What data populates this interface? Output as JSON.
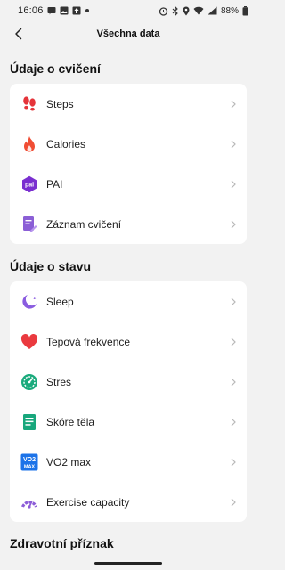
{
  "status_bar": {
    "time": "16:06",
    "battery": "88%"
  },
  "header": {
    "title": "Všechna data"
  },
  "sections": [
    {
      "title": "Údaje o cvičení",
      "items": [
        {
          "label": "Steps",
          "icon": "footsteps-icon",
          "color": "#e5343a"
        },
        {
          "label": "Calories",
          "icon": "flame-icon",
          "color": "#f04d34"
        },
        {
          "label": "PAI",
          "icon": "pai-icon",
          "color": "#7a2fd0"
        },
        {
          "label": "Záznam cvičení",
          "icon": "exercise-record-icon",
          "color": "#8b5fd6"
        }
      ]
    },
    {
      "title": "Údaje o stavu",
      "items": [
        {
          "label": "Sleep",
          "icon": "moon-icon",
          "color": "#8a5ce0"
        },
        {
          "label": "Tepová frekvence",
          "icon": "heart-icon",
          "color": "#ea3a3f"
        },
        {
          "label": "Stres",
          "icon": "stress-gauge-icon",
          "color": "#1aaa7c"
        },
        {
          "label": "Skóre těla",
          "icon": "body-score-icon",
          "color": "#18a77c"
        },
        {
          "label": "VO2 max",
          "icon": "vo2max-icon",
          "color": "#1c73e8"
        },
        {
          "label": "Exercise capacity",
          "icon": "capacity-gauge-icon",
          "color": "#8c5cd8"
        }
      ]
    },
    {
      "title": "Zdravotní příznak"
    }
  ],
  "icons": {
    "pai_text": "pai",
    "vo2_top": "VO2",
    "vo2_bottom": "MAX"
  }
}
